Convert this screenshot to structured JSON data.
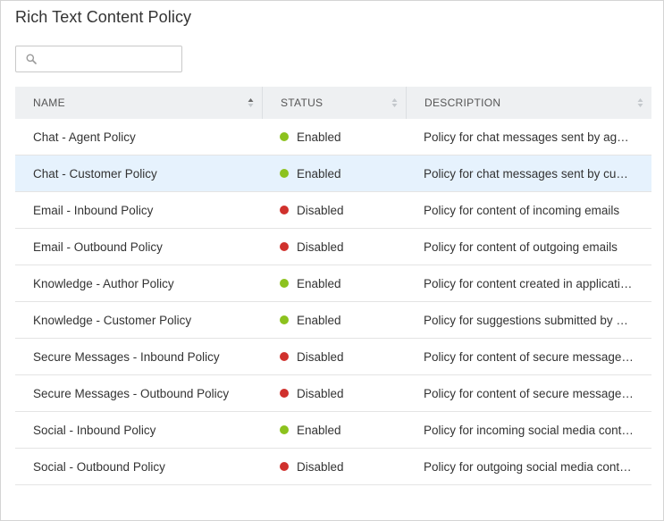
{
  "page": {
    "title": "Rich Text Content Policy"
  },
  "search": {
    "placeholder": "",
    "value": ""
  },
  "colors": {
    "enabled": "#8cc21e",
    "disabled": "#d0312d",
    "selected_row": "#e6f2fd",
    "header_bg": "#eef0f2"
  },
  "table": {
    "columns": [
      "NAME",
      "STATUS",
      "DESCRIPTION"
    ],
    "rows": [
      {
        "name": "Chat - Agent Policy",
        "status": "Enabled",
        "description": "Policy for chat messages sent by age…"
      },
      {
        "name": "Chat - Customer Policy",
        "status": "Enabled",
        "description": "Policy for chat messages sent by cust…",
        "selected": true
      },
      {
        "name": "Email - Inbound Policy",
        "status": "Disabled",
        "description": "Policy for content of incoming emails"
      },
      {
        "name": "Email - Outbound Policy",
        "status": "Disabled",
        "description": "Policy for content of outgoing emails"
      },
      {
        "name": "Knowledge - Author Policy",
        "status": "Enabled",
        "description": "Policy for content created in applicati…"
      },
      {
        "name": "Knowledge - Customer Policy",
        "status": "Enabled",
        "description": "Policy for suggestions submitted by c…"
      },
      {
        "name": "Secure Messages - Inbound Policy",
        "status": "Disabled",
        "description": "Policy for content of secure message…"
      },
      {
        "name": "Secure Messages - Outbound Policy",
        "status": "Disabled",
        "description": "Policy for content of secure message…"
      },
      {
        "name": "Social - Inbound Policy",
        "status": "Enabled",
        "description": "Policy for incoming social media cont…"
      },
      {
        "name": "Social - Outbound Policy",
        "status": "Disabled",
        "description": "Policy for outgoing social media cont…"
      }
    ]
  }
}
